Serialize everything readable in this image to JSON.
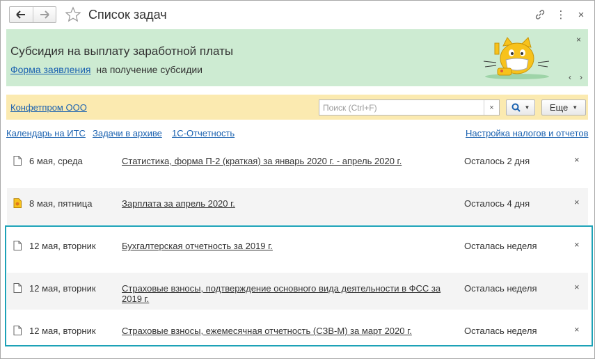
{
  "window": {
    "title": "Список задач",
    "nav": {
      "back_icon": "arrow-left",
      "forward_icon": "arrow-right"
    },
    "favorite_icon": "star",
    "link_icon": "link",
    "menu_icon": "⋮",
    "close_icon": "×"
  },
  "banner": {
    "title": "Субсидия на выплату заработной платы",
    "link_text": "Форма заявления",
    "text": "на получение субсидии",
    "close_icon": "×",
    "prev_icon": "‹",
    "next_icon": "›",
    "background": "#cdebd2"
  },
  "company": {
    "name": "Конфетпром ООО",
    "background": "#fbeab0"
  },
  "search": {
    "placeholder": "Поиск (Ctrl+F)",
    "value": "",
    "clear_icon": "×"
  },
  "toolbar": {
    "more_label": "Еще",
    "caret": "▼"
  },
  "links": {
    "calendar": "Календарь на ИТС",
    "archive": "Задачи в архиве",
    "reporting": "1С-Отчетность",
    "settings": "Настройка налогов и отчетов"
  },
  "tasks": [
    {
      "date": "6 мая, среда",
      "title": "Статистика, форма П-2 (краткая) за январь 2020 г. - апрель 2020 г.",
      "status": "Осталось 2 дня",
      "icon": "document",
      "close": "×"
    },
    {
      "date": "8 мая, пятница",
      "title": "Зарплата за апрель 2020 г.",
      "status": "Осталось 4 дня",
      "icon": "salary-document",
      "close": "×"
    },
    {
      "date": "12 мая, вторник",
      "title": "Бухгалтерская отчетность за 2019 г.",
      "status": "Осталась неделя",
      "icon": "document",
      "close": "×"
    },
    {
      "date": "12 мая, вторник",
      "title": "Страховые взносы, подтверждение основного вида деятельности в ФСС за 2019 г.",
      "status": "Осталась неделя",
      "icon": "document",
      "close": "×"
    },
    {
      "date": "12 мая, вторник",
      "title": "Страховые взносы, ежемесячная отчетность (СЗВ-М) за март 2020 г.",
      "status": "Осталась неделя",
      "icon": "document",
      "close": "×"
    }
  ],
  "colors": {
    "link": "#1b62b0",
    "highlight": "#1da2b7",
    "alt_row": "#f4f4f4"
  }
}
